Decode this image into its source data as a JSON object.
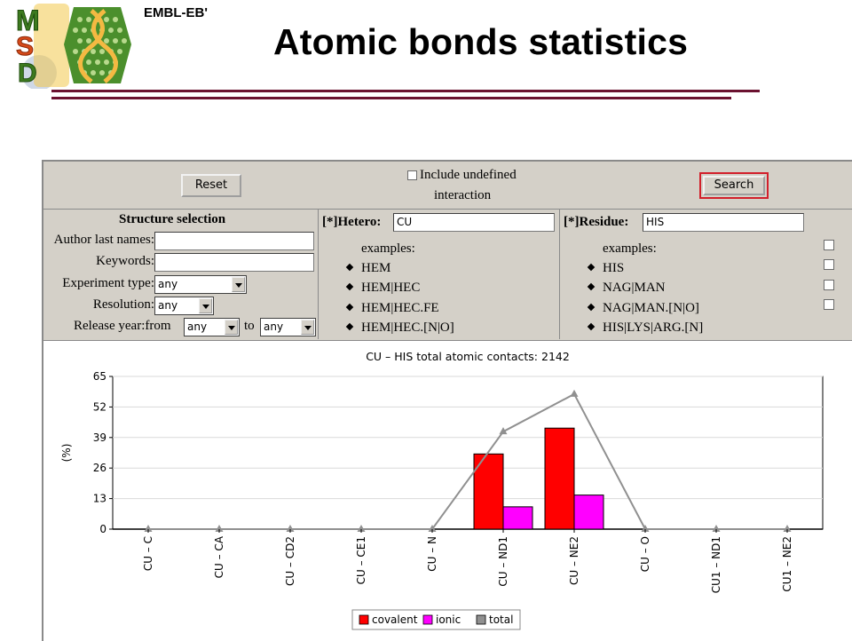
{
  "header": {
    "logo_letters": [
      "M",
      "S",
      "D"
    ],
    "org": "EMBL-EB'",
    "title": "Atomic bonds statistics"
  },
  "toolbar": {
    "reset_label": "Reset",
    "search_label": "Search",
    "include_undefined_line1": "Include undefined",
    "include_undefined_line2": "interaction",
    "include_undefined_checked": false
  },
  "structure_selection": {
    "heading": "Structure selection",
    "author_label": "Author last names:",
    "author_value": "",
    "keywords_label": "Keywords:",
    "keywords_value": "",
    "experiment_label": "Experiment type:",
    "experiment_value": "any",
    "resolution_label": "Resolution:",
    "resolution_value": "any",
    "release_label": "Release year:from",
    "release_from": "any",
    "release_to_label": "to",
    "release_to": "any"
  },
  "hetero": {
    "label": "[*]Hetero:",
    "value": "CU",
    "examples_label": "examples:",
    "examples": [
      "HEM",
      "HEM|HEC",
      "HEM|HEC.FE",
      "HEM|HEC.[N|O]"
    ]
  },
  "residue": {
    "label": "[*]Residue:",
    "value": "HIS",
    "examples_label": "examples:",
    "examples": [
      "HIS",
      "NAG|MAN",
      "NAG|MAN.[N|O]",
      "HIS|LYS|ARG.[N]"
    ]
  },
  "colors": {
    "covalent": "#ff0000",
    "ionic": "#ff00ff",
    "total": "#909090",
    "accent_rule": "#6b1230",
    "search_border": "#d21f2b"
  },
  "chart_data": {
    "type": "bar",
    "title": "CU – HIS total atomic contacts: 2142",
    "ylabel": "(%)",
    "xlabel": "",
    "ylim": [
      0,
      65
    ],
    "yticks": [
      0,
      13,
      26,
      39,
      52,
      65
    ],
    "categories": [
      "CU – C",
      "CU – CA",
      "CU – CD2",
      "CU – CE1",
      "CU – N",
      "CU – ND1",
      "CU – NE2",
      "CU – O",
      "CU1 – ND1",
      "CU1 – NE2"
    ],
    "series": [
      {
        "name": "covalent",
        "kind": "bar",
        "values": [
          0,
          0,
          0,
          0,
          0,
          32,
          43,
          0,
          0,
          0
        ]
      },
      {
        "name": "ionic",
        "kind": "bar",
        "values": [
          0,
          0,
          0,
          0,
          0,
          9.5,
          14.5,
          0,
          0,
          0
        ]
      },
      {
        "name": "total",
        "kind": "line",
        "values": [
          0,
          0,
          0,
          0,
          0,
          41.5,
          57.5,
          0,
          0,
          0
        ]
      }
    ],
    "legend": [
      "covalent",
      "ionic",
      "total"
    ],
    "legend_position": "bottom"
  }
}
